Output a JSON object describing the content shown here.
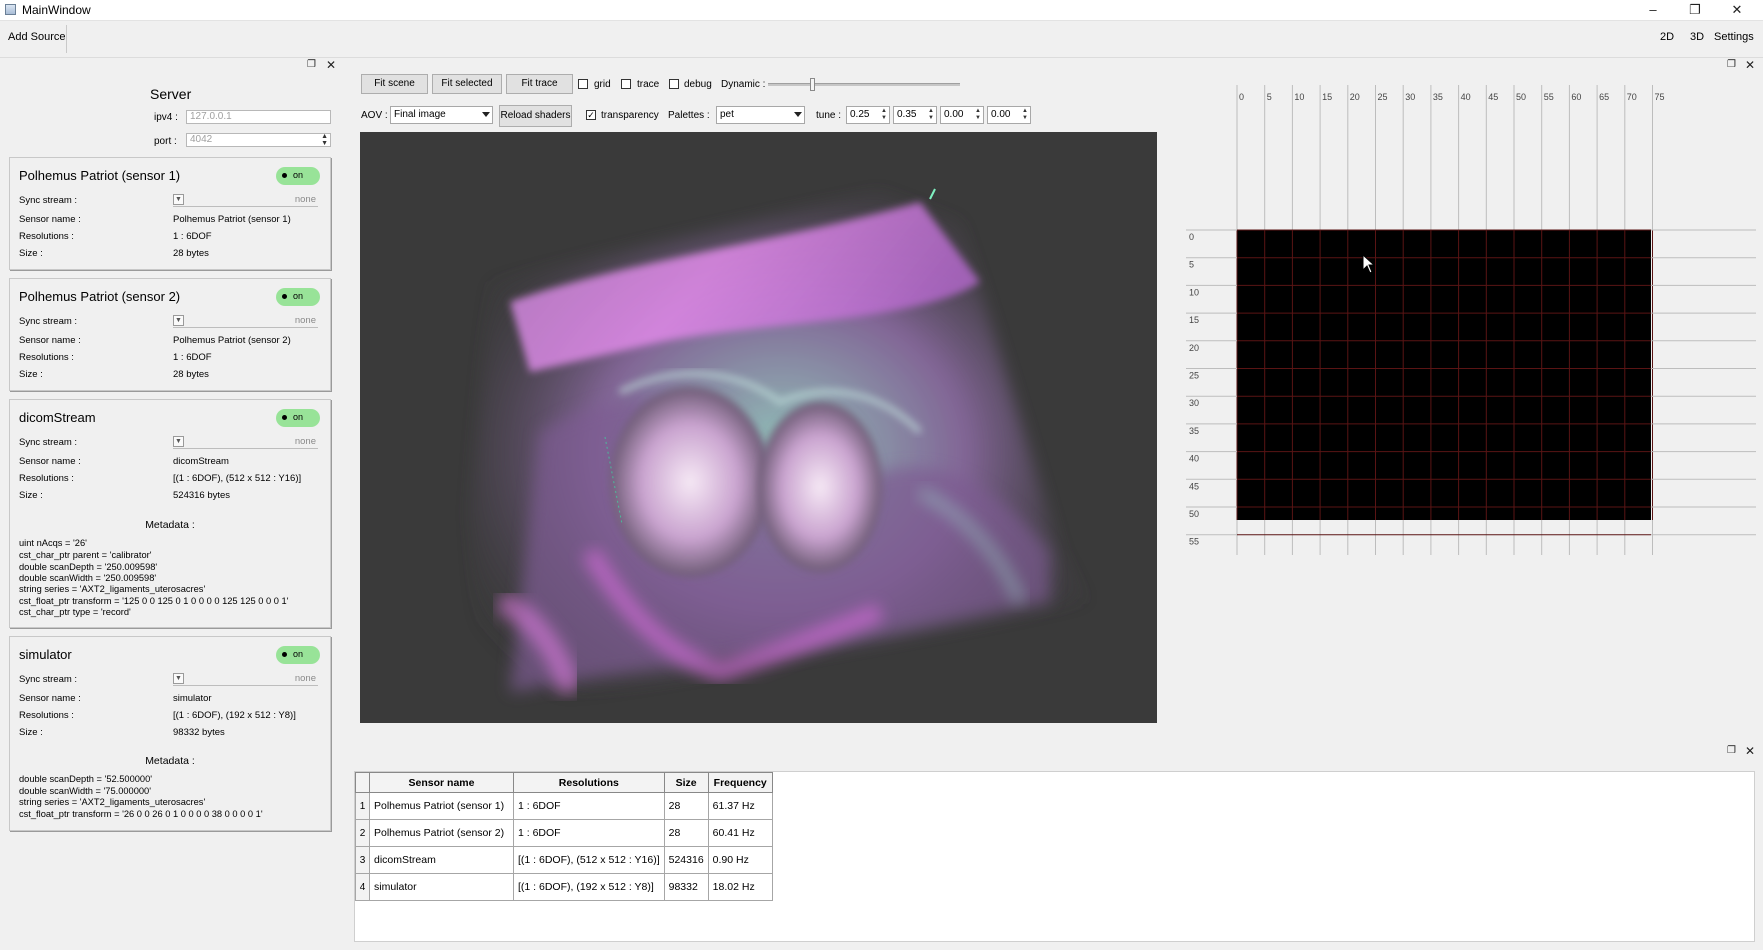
{
  "window": {
    "title": "MainWindow",
    "controls": [
      "–",
      "❐",
      "✕"
    ]
  },
  "toolbar": {
    "add_source": "Add Source",
    "view_2d": "2D",
    "view_3d": "3D",
    "settings": "Settings"
  },
  "server": {
    "title": "Server",
    "ipv4_label": "ipv4 :",
    "ipv4_value": "127.0.0.1",
    "port_label": "port :",
    "port_value": "4042"
  },
  "sources": [
    {
      "title": "Polhemus Patriot (sensor 1)",
      "toggle": "on",
      "sync_label": "Sync stream :",
      "sync_value": "none",
      "name_label": "Sensor name :",
      "name_value": "Polhemus Patriot (sensor 1)",
      "res_label": "Resolutions :",
      "res_value": "1 : 6DOF",
      "size_label": "Size :",
      "size_value": "28 bytes"
    },
    {
      "title": "Polhemus Patriot (sensor 2)",
      "toggle": "on",
      "sync_label": "Sync stream :",
      "sync_value": "none",
      "name_label": "Sensor name :",
      "name_value": "Polhemus Patriot (sensor 2)",
      "res_label": "Resolutions :",
      "res_value": "1 : 6DOF",
      "size_label": "Size :",
      "size_value": "28 bytes"
    },
    {
      "title": "dicomStream",
      "toggle": "on",
      "sync_label": "Sync stream :",
      "sync_value": "none",
      "name_label": "Sensor name :",
      "name_value": "dicomStream",
      "res_label": "Resolutions :",
      "res_value": "[(1 : 6DOF), (512 x 512 : Y16)]",
      "size_label": "Size :",
      "size_value": "524316 bytes",
      "metadata_title": "Metadata :",
      "metadata": [
        "uint nAcqs = '26'",
        "cst_char_ptr parent = 'calibrator'",
        "double scanDepth = '250.009598'",
        "double scanWidth = '250.009598'",
        "string series = 'AXT2_ligaments_uterosacres'",
        "cst_float_ptr transform = '125 0 0 125  0 1 0 0  0 0 125 125  0 0 0 1'",
        "cst_char_ptr type = 'record'"
      ]
    },
    {
      "title": "simulator",
      "toggle": "on",
      "sync_label": "Sync stream :",
      "sync_value": "none",
      "name_label": "Sensor name :",
      "name_value": "simulator",
      "res_label": "Resolutions :",
      "res_value": "[(1 : 6DOF), (192 x 512 : Y8)]",
      "size_label": "Size :",
      "size_value": "98332 bytes",
      "metadata_title": "Metadata :",
      "metadata": [
        "double scanDepth = '52.500000'",
        "double scanWidth = '75.000000'",
        "string series = 'AXT2_ligaments_uterosacres'",
        "cst_float_ptr transform = '26 0 0 26  0 1 0 0  0 0 38 0  0 0 0 1'"
      ]
    }
  ],
  "viewer": {
    "fit_scene": "Fit scene",
    "fit_selected": "Fit selected",
    "fit_trace": "Fit trace",
    "grid_label": "grid",
    "trace_label": "trace",
    "debug_label": "debug",
    "dynamic_label": "Dynamic :",
    "dynamic_level": 0.22,
    "aov_label": "AOV :",
    "aov_value": "Final image",
    "reload_shaders": "Reload shaders",
    "transparency_label": "transparency",
    "transparency_checked": true,
    "palettes_label": "Palettes :",
    "palettes_value": "pet",
    "tune_label": "tune :",
    "tune_values": [
      "0.25",
      "0.35",
      "0.00",
      "0.00"
    ]
  },
  "grid_view": {
    "x_ticks": [
      "0",
      "5",
      "10",
      "15",
      "20",
      "25",
      "30",
      "35",
      "40",
      "45",
      "50",
      "55",
      "60",
      "65",
      "70",
      "75"
    ],
    "y_ticks": [
      "0",
      "5",
      "10",
      "15",
      "20",
      "25",
      "30",
      "35",
      "40",
      "45",
      "50",
      "55"
    ]
  },
  "table": {
    "headers": [
      "Sensor name",
      "Resolutions",
      "Size",
      "Frequency"
    ],
    "rows": [
      [
        "1",
        "Polhemus Patriot (sensor 1)",
        "1 : 6DOF",
        "28",
        "61.37 Hz"
      ],
      [
        "2",
        "Polhemus Patriot (sensor 2)",
        "1 : 6DOF",
        "28",
        "60.41 Hz"
      ],
      [
        "3",
        "dicomStream",
        "[(1 : 6DOF), (512 x 512 : Y16)]",
        "524316",
        "0.90 Hz"
      ],
      [
        "4",
        "simulator",
        "[(1 : 6DOF), (192 x 512 : Y8)]",
        "98332",
        "18.02 Hz"
      ]
    ]
  },
  "colors": {
    "toggle_on": "#98e398",
    "grid_line": "#5a1414",
    "palette_magenta": "#d86ad8",
    "palette_teal": "#7fd1c7"
  }
}
